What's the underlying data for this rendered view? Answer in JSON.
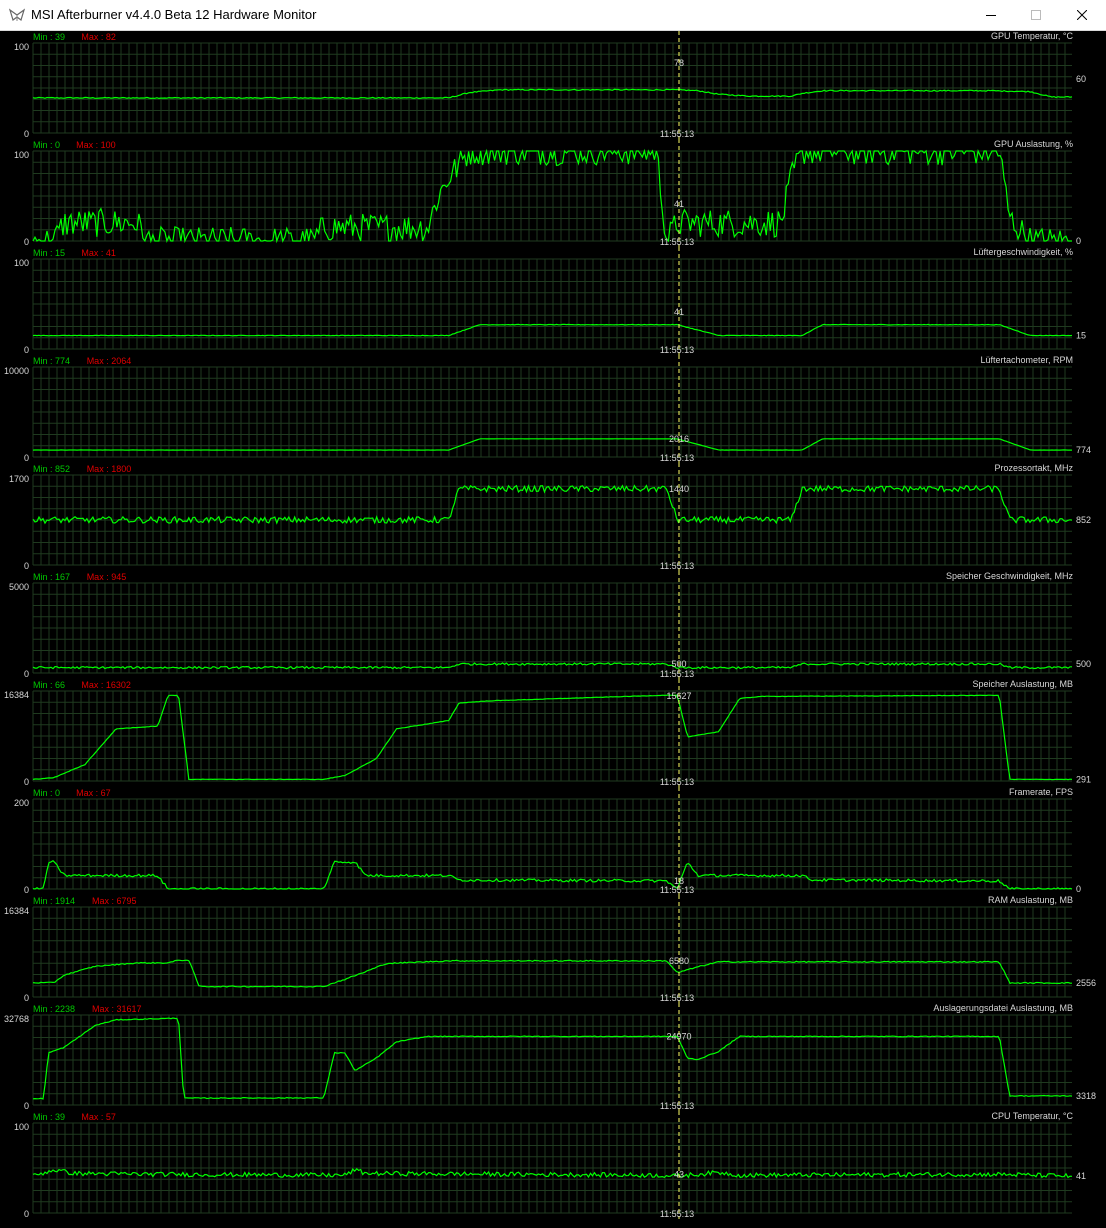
{
  "window": {
    "title": "MSI Afterburner v4.4.0 Beta 12 Hardware Monitor",
    "icons": {
      "app": "afterburner-logo-icon",
      "minimize": "minimize-icon",
      "maximize": "maximize-icon",
      "close": "close-icon"
    }
  },
  "colors": {
    "background": "#000000",
    "grid": "#1f3a1f",
    "trace": "#00ff00",
    "cursor": "#ffff66",
    "min_text": "#00c800",
    "max_text": "#e00000",
    "label_text": "#d6d6d6"
  },
  "cursor_time": "11:55:13",
  "graphs": [
    {
      "name": "GPU Temperatur, °C",
      "min_label": "Min : 39",
      "max_label": "Max : 82",
      "axis_max": "100",
      "axis_min": "0",
      "scale_max": 100,
      "current": "60",
      "cursor_value": "78",
      "profile": [
        [
          0,
          39
        ],
        [
          0.4,
          39
        ],
        [
          0.42,
          45
        ],
        [
          0.45,
          48
        ],
        [
          0.5,
          48
        ],
        [
          0.62,
          48
        ],
        [
          0.64,
          47
        ],
        [
          0.66,
          43
        ],
        [
          0.69,
          41
        ],
        [
          0.73,
          41
        ],
        [
          0.74,
          44
        ],
        [
          0.76,
          47
        ],
        [
          0.86,
          47
        ],
        [
          0.92,
          47
        ],
        [
          0.96,
          46
        ],
        [
          0.98,
          40
        ],
        [
          1,
          40
        ]
      ],
      "noise": 0.6
    },
    {
      "name": "GPU Auslastung, %",
      "min_label": "Min : 0",
      "max_label": "Max : 100",
      "axis_max": "100",
      "axis_min": "0",
      "scale_max": 100,
      "current": "0",
      "cursor_value": "41",
      "profile": [
        [
          0,
          0
        ],
        [
          0.02,
          0
        ],
        [
          0.03,
          20
        ],
        [
          0.1,
          20
        ],
        [
          0.11,
          0
        ],
        [
          0.27,
          0
        ],
        [
          0.28,
          15
        ],
        [
          0.38,
          15
        ],
        [
          0.39,
          50
        ],
        [
          0.4,
          70
        ],
        [
          0.42,
          100
        ],
        [
          0.6,
          100
        ],
        [
          0.61,
          0
        ],
        [
          0.62,
          20
        ],
        [
          0.72,
          20
        ],
        [
          0.73,
          70
        ],
        [
          0.74,
          100
        ],
        [
          0.93,
          100
        ],
        [
          0.94,
          25
        ],
        [
          0.96,
          0
        ],
        [
          1,
          0
        ]
      ],
      "noise": 16
    },
    {
      "name": "Lüftergeschwindigkeit, %",
      "min_label": "Min : 15",
      "max_label": "Max : 41",
      "axis_max": "100",
      "axis_min": "0",
      "scale_max": 100,
      "current": "15",
      "cursor_value": "41",
      "profile": [
        [
          0,
          15
        ],
        [
          0.4,
          15
        ],
        [
          0.43,
          27
        ],
        [
          0.47,
          27
        ],
        [
          0.62,
          27
        ],
        [
          0.66,
          15
        ],
        [
          0.74,
          15
        ],
        [
          0.76,
          27
        ],
        [
          0.93,
          27
        ],
        [
          0.96,
          15
        ],
        [
          1,
          15
        ]
      ],
      "noise": 0.3
    },
    {
      "name": "Lüftertachometer, RPM",
      "min_label": "Min : 774",
      "max_label": "Max : 2064",
      "axis_max": "10000",
      "axis_min": "0",
      "scale_max": 10000,
      "current": "774",
      "cursor_value": "2016",
      "profile": [
        [
          0,
          774
        ],
        [
          0.4,
          774
        ],
        [
          0.43,
          2016
        ],
        [
          0.62,
          2016
        ],
        [
          0.66,
          774
        ],
        [
          0.74,
          774
        ],
        [
          0.76,
          2016
        ],
        [
          0.93,
          2016
        ],
        [
          0.96,
          774
        ],
        [
          1,
          774
        ]
      ],
      "noise": 10
    },
    {
      "name": "Prozessortakt, MHz",
      "min_label": "Min : 852",
      "max_label": "Max : 1800",
      "axis_max": "1700",
      "axis_min": "0",
      "scale_max": 1700,
      "current": "852",
      "cursor_value": "1440",
      "profile": [
        [
          0,
          852
        ],
        [
          0.4,
          852
        ],
        [
          0.41,
          1440
        ],
        [
          0.61,
          1440
        ],
        [
          0.62,
          852
        ],
        [
          0.73,
          852
        ],
        [
          0.74,
          1440
        ],
        [
          0.93,
          1440
        ],
        [
          0.94,
          852
        ],
        [
          1,
          852
        ]
      ],
      "noise": 60
    },
    {
      "name": "Speicher Geschwindigkeit, MHz",
      "min_label": "Min : 167",
      "max_label": "Max : 945",
      "axis_max": "5000",
      "axis_min": "0",
      "scale_max": 5000,
      "current": "500",
      "cursor_value": "500",
      "profile": [
        [
          0,
          300
        ],
        [
          0.4,
          300
        ],
        [
          0.41,
          500
        ],
        [
          0.61,
          500
        ],
        [
          0.62,
          300
        ],
        [
          0.73,
          300
        ],
        [
          0.74,
          500
        ],
        [
          0.93,
          500
        ],
        [
          0.94,
          300
        ],
        [
          1,
          300
        ]
      ],
      "noise": 60
    },
    {
      "name": "Speicher Auslastung, MB",
      "min_label": "Min : 66",
      "max_label": "Max : 16302",
      "axis_max": "16384",
      "axis_min": "0",
      "scale_max": 16384,
      "current": "291",
      "cursor_value": "15627",
      "profile": [
        [
          0,
          300
        ],
        [
          0.02,
          600
        ],
        [
          0.05,
          3000
        ],
        [
          0.08,
          9500
        ],
        [
          0.12,
          10000
        ],
        [
          0.13,
          15600
        ],
        [
          0.14,
          15600
        ],
        [
          0.15,
          300
        ],
        [
          0.28,
          300
        ],
        [
          0.3,
          1000
        ],
        [
          0.33,
          4000
        ],
        [
          0.35,
          9500
        ],
        [
          0.4,
          11000
        ],
        [
          0.41,
          14200
        ],
        [
          0.44,
          14600
        ],
        [
          0.61,
          15627
        ],
        [
          0.62,
          15600
        ],
        [
          0.63,
          8000
        ],
        [
          0.66,
          9000
        ],
        [
          0.68,
          15000
        ],
        [
          0.7,
          15400
        ],
        [
          0.93,
          15600
        ],
        [
          0.94,
          300
        ],
        [
          1,
          291
        ]
      ],
      "noise": 40
    },
    {
      "name": "Framerate, FPS",
      "min_label": "Min : 0",
      "max_label": "Max : 67",
      "axis_max": "200",
      "axis_min": "0",
      "scale_max": 200,
      "current": "0",
      "cursor_value": "18",
      "profile": [
        [
          0,
          0
        ],
        [
          0.01,
          0
        ],
        [
          0.015,
          60
        ],
        [
          0.02,
          60
        ],
        [
          0.03,
          30
        ],
        [
          0.12,
          30
        ],
        [
          0.13,
          0
        ],
        [
          0.28,
          0
        ],
        [
          0.29,
          60
        ],
        [
          0.31,
          60
        ],
        [
          0.32,
          30
        ],
        [
          0.4,
          30
        ],
        [
          0.41,
          20
        ],
        [
          0.61,
          18
        ],
        [
          0.62,
          0
        ],
        [
          0.63,
          60
        ],
        [
          0.64,
          30
        ],
        [
          0.74,
          30
        ],
        [
          0.75,
          20
        ],
        [
          0.93,
          18
        ],
        [
          0.94,
          0
        ],
        [
          1,
          0
        ]
      ],
      "noise": 3
    },
    {
      "name": "RAM Auslastung, MB",
      "min_label": "Min : 1914",
      "max_label": "Max : 6795",
      "axis_max": "16384",
      "axis_min": "0",
      "scale_max": 16384,
      "current": "2556",
      "cursor_value": "6580",
      "profile": [
        [
          0,
          2600
        ],
        [
          0.02,
          2600
        ],
        [
          0.03,
          4000
        ],
        [
          0.06,
          5600
        ],
        [
          0.1,
          6200
        ],
        [
          0.13,
          6200
        ],
        [
          0.14,
          6700
        ],
        [
          0.15,
          6700
        ],
        [
          0.16,
          1914
        ],
        [
          0.28,
          1914
        ],
        [
          0.29,
          2600
        ],
        [
          0.3,
          3200
        ],
        [
          0.32,
          4600
        ],
        [
          0.34,
          6100
        ],
        [
          0.4,
          6580
        ],
        [
          0.61,
          6580
        ],
        [
          0.62,
          4400
        ],
        [
          0.64,
          5500
        ],
        [
          0.66,
          6400
        ],
        [
          0.93,
          6400
        ],
        [
          0.94,
          2556
        ],
        [
          1,
          2556
        ]
      ],
      "noise": 100
    },
    {
      "name": "Auslagerungsdatei Auslastung, MB",
      "min_label": "Min : 2238",
      "max_label": "Max : 31617",
      "axis_max": "32768",
      "axis_min": "0",
      "scale_max": 32768,
      "current": "3318",
      "cursor_value": "24970",
      "profile": [
        [
          0,
          2300
        ],
        [
          0.01,
          2300
        ],
        [
          0.015,
          19000
        ],
        [
          0.03,
          21000
        ],
        [
          0.06,
          29000
        ],
        [
          0.08,
          31000
        ],
        [
          0.14,
          31617
        ],
        [
          0.145,
          2500
        ],
        [
          0.28,
          2600
        ],
        [
          0.29,
          19000
        ],
        [
          0.3,
          19000
        ],
        [
          0.31,
          12500
        ],
        [
          0.33,
          17000
        ],
        [
          0.35,
          23000
        ],
        [
          0.38,
          24970
        ],
        [
          0.62,
          24970
        ],
        [
          0.63,
          17000
        ],
        [
          0.64,
          16600
        ],
        [
          0.66,
          19500
        ],
        [
          0.68,
          24970
        ],
        [
          0.93,
          24970
        ],
        [
          0.94,
          3318
        ],
        [
          1,
          3318
        ]
      ],
      "noise": 150
    },
    {
      "name": "CPU Temperatur, °C",
      "min_label": "Min : 39",
      "max_label": "Max : 57",
      "axis_max": "100",
      "axis_min": "0",
      "scale_max": 100,
      "current": "41",
      "cursor_value": "43",
      "profile": [
        [
          0,
          41
        ],
        [
          0.02,
          48
        ],
        [
          0.04,
          44
        ],
        [
          0.12,
          43
        ],
        [
          0.3,
          42
        ],
        [
          0.31,
          48
        ],
        [
          0.32,
          44
        ],
        [
          0.6,
          42
        ],
        [
          0.62,
          41
        ],
        [
          0.66,
          45
        ],
        [
          0.68,
          42
        ],
        [
          0.93,
          43
        ],
        [
          1,
          41
        ]
      ],
      "noise": 2.5
    }
  ]
}
